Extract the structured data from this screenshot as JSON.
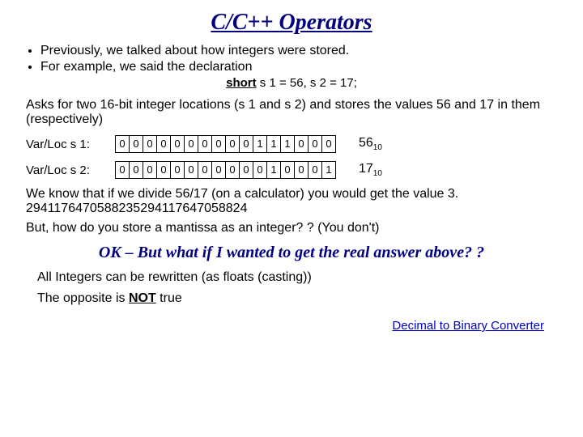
{
  "title": "C/C++  Operators",
  "bullets": [
    "Previously, we talked about how integers were stored.",
    "For example, we said the declaration"
  ],
  "decl_kw": "short",
  "decl_rest": " s 1 = 56, s 2 = 17;",
  "asks_text": "Asks for two 16-bit integer locations (s 1 and s 2) and stores the values 56 and 17 in them (respectively)",
  "rows": [
    {
      "label": "Var/Loc s 1:",
      "bits": [
        "0",
        "0",
        "0",
        "0",
        "0",
        "0",
        "0",
        "0",
        "0",
        "0",
        "1",
        "1",
        "1",
        "0",
        "0",
        "0"
      ],
      "dec": "56",
      "base": "10"
    },
    {
      "label": "Var/Loc s 2:",
      "bits": [
        "0",
        "0",
        "0",
        "0",
        "0",
        "0",
        "0",
        "0",
        "0",
        "0",
        "0",
        "1",
        "0",
        "0",
        "0",
        "1"
      ],
      "dec": "17",
      "base": "10"
    }
  ],
  "divide_text": "We know that if we divide 56/17 (on a calculator) you would get the value 3. 2941176470588235294117647058824",
  "mantissa_q": "But, how do you store a mantissa as an integer? ?  (You don't)",
  "ok_question": "OK – But what if I wanted to get the real answer above? ?",
  "cast_line": "All Integers can be rewritten (as floats (casting))",
  "opposite_pre": "The opposite is ",
  "opposite_not": "NOT",
  "opposite_post": " true",
  "link_label": "Decimal to Binary Converter"
}
